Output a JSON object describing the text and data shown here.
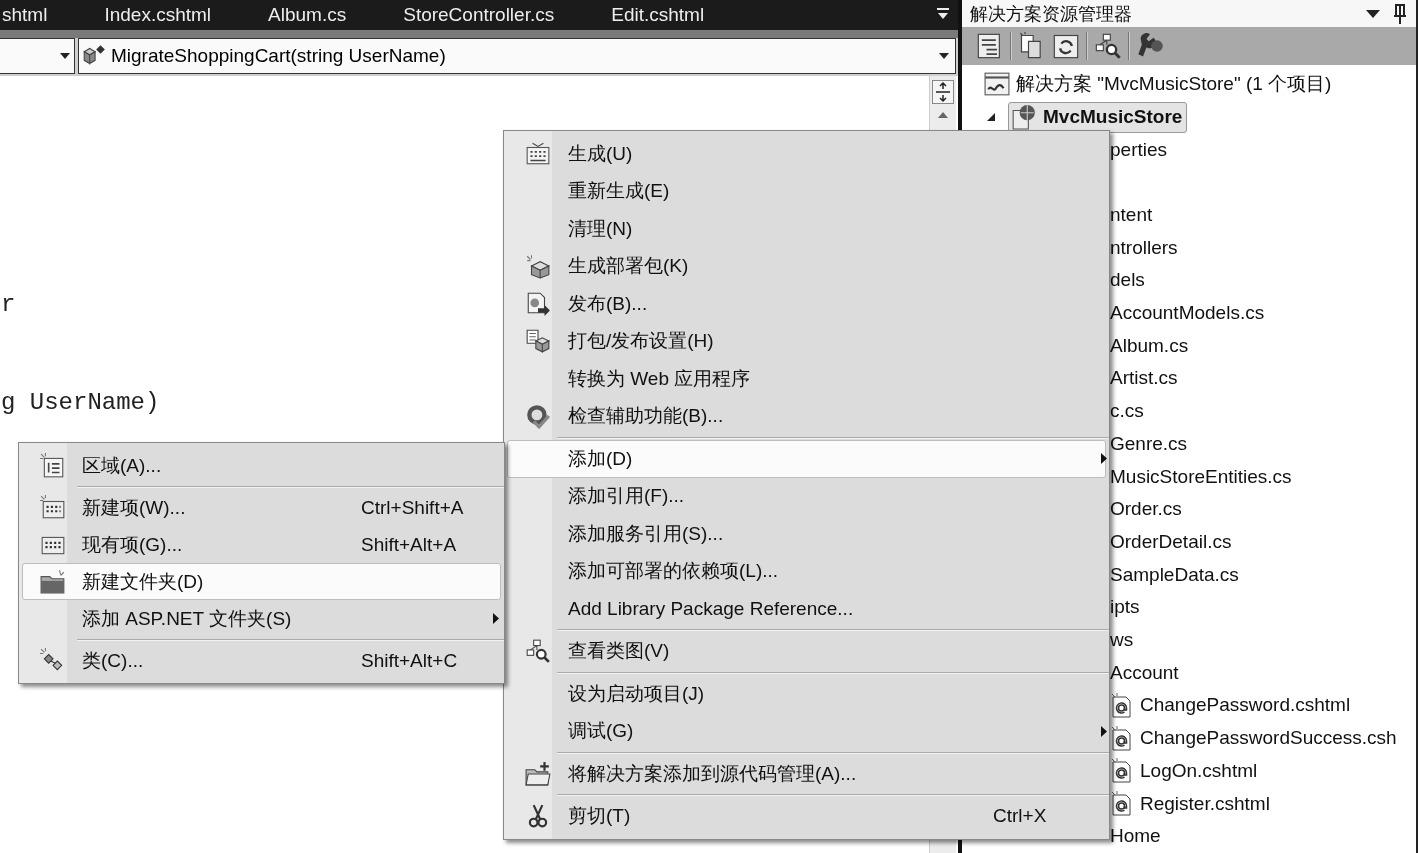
{
  "editor_tabs": [
    {
      "label": "shtml",
      "selected": false
    },
    {
      "label": "Index.cshtml",
      "selected": false
    },
    {
      "label": "Album.cs",
      "selected": false
    },
    {
      "label": "StoreController.cs",
      "selected": false
    },
    {
      "label": "Edit.cshtml",
      "selected": false
    }
  ],
  "navigation_bar": {
    "member_dropdown": {
      "value": "MigrateShoppingCart(string UserName)"
    }
  },
  "editor": {
    "code_lines": [
      "r",
      "g UserName)"
    ]
  },
  "solution_explorer": {
    "title": "解决方案资源管理器",
    "tree": [
      {
        "kind": "solution",
        "label": "解决方案 \"MvcMusicStore\" (1 个项目)",
        "selected": false,
        "children": [
          {
            "kind": "project",
            "label": "MvcMusicStore",
            "selected": true,
            "expanded": true,
            "children": [
              {
                "label": "perties",
                "selected": false
              },
              {
                "kind": "covered"
              },
              {
                "label": "ntent",
                "selected": false
              },
              {
                "label": "ntrollers",
                "selected": false
              },
              {
                "label": "dels",
                "selected": false,
                "children": [
                  {
                    "label": "AccountModels.cs",
                    "selected": false
                  },
                  {
                    "label": "Album.cs",
                    "selected": false
                  },
                  {
                    "label": "Artist.cs",
                    "selected": false
                  },
                  {
                    "label": "c.cs",
                    "selected": false
                  },
                  {
                    "label": "Genre.cs",
                    "selected": false
                  },
                  {
                    "label": "MusicStoreEntities.cs",
                    "selected": false
                  },
                  {
                    "label": "Order.cs",
                    "selected": false
                  },
                  {
                    "label": "OrderDetail.cs",
                    "selected": false
                  },
                  {
                    "label": "SampleData.cs",
                    "selected": false
                  }
                ]
              },
              {
                "label": "ipts",
                "selected": false
              },
              {
                "label": "ws",
                "selected": false,
                "children": [
                  {
                    "label": "Account",
                    "selected": false,
                    "children": [
                      {
                        "kind": "razor-file",
                        "label": "ChangePassword.cshtml",
                        "selected": false
                      },
                      {
                        "kind": "razor-file",
                        "label": "ChangePasswordSuccess.csh",
                        "selected": false
                      },
                      {
                        "kind": "razor-file",
                        "label": "LogOn.cshtml",
                        "selected": false
                      },
                      {
                        "kind": "razor-file",
                        "label": "Register.cshtml",
                        "selected": false
                      }
                    ]
                  },
                  {
                    "label": "Home",
                    "selected": false
                  }
                ]
              }
            ]
          }
        ]
      }
    ]
  },
  "context_menu": {
    "items": [
      {
        "kind": "item",
        "label": "生成(U)",
        "selected": false,
        "submenu": false
      },
      {
        "kind": "item",
        "label": "重新生成(E)",
        "selected": false,
        "submenu": false
      },
      {
        "kind": "item",
        "label": "清理(N)",
        "selected": false,
        "submenu": false
      },
      {
        "kind": "item",
        "label": "生成部署包(K)",
        "selected": false,
        "submenu": false
      },
      {
        "kind": "item",
        "label": "发布(B)...",
        "selected": false,
        "submenu": false
      },
      {
        "kind": "item",
        "label": "打包/发布设置(H)",
        "selected": false,
        "submenu": false
      },
      {
        "kind": "item",
        "label": "转换为 Web 应用程序",
        "selected": false,
        "submenu": false
      },
      {
        "kind": "item",
        "label": "检查辅助功能(B)...",
        "selected": false,
        "submenu": false
      },
      {
        "kind": "separator"
      },
      {
        "kind": "item",
        "label": "添加(D)",
        "selected": true,
        "submenu": true
      },
      {
        "kind": "item",
        "label": "添加引用(F)...",
        "selected": false,
        "submenu": false
      },
      {
        "kind": "item",
        "label": "添加服务引用(S)...",
        "selected": false,
        "submenu": false
      },
      {
        "kind": "item",
        "label": "添加可部署的依赖项(L)...",
        "selected": false,
        "submenu": false
      },
      {
        "kind": "item",
        "label": "Add Library Package Reference...",
        "selected": false,
        "submenu": false
      },
      {
        "kind": "separator"
      },
      {
        "kind": "item",
        "label": "查看类图(V)",
        "selected": false,
        "submenu": false
      },
      {
        "kind": "separator"
      },
      {
        "kind": "item",
        "label": "设为启动项目(J)",
        "selected": false,
        "submenu": false
      },
      {
        "kind": "item",
        "label": "调试(G)",
        "selected": false,
        "submenu": true
      },
      {
        "kind": "separator"
      },
      {
        "kind": "item",
        "label": "将解决方案添加到源代码管理(A)...",
        "selected": false,
        "submenu": false
      },
      {
        "kind": "separator"
      },
      {
        "kind": "item",
        "label": "剪切(T)",
        "shortcut": "Ctrl+X",
        "selected": false,
        "submenu": false
      }
    ]
  },
  "add_submenu": {
    "items": [
      {
        "kind": "item",
        "label": "区域(A)...",
        "selected": false,
        "submenu": false
      },
      {
        "kind": "separator"
      },
      {
        "kind": "item",
        "label": "新建项(W)...",
        "shortcut": "Ctrl+Shift+A",
        "selected": false,
        "submenu": false
      },
      {
        "kind": "item",
        "label": "现有项(G)...",
        "shortcut": "Shift+Alt+A",
        "selected": false,
        "submenu": false
      },
      {
        "kind": "item",
        "label": "新建文件夹(D)",
        "selected": true,
        "submenu": false
      },
      {
        "kind": "item",
        "label": "添加 ASP.NET 文件夹(S)",
        "selected": false,
        "submenu": true
      },
      {
        "kind": "separator"
      },
      {
        "kind": "item",
        "label": "类(C)...",
        "shortcut": "Shift+Alt+C",
        "selected": false,
        "submenu": false
      }
    ]
  }
}
